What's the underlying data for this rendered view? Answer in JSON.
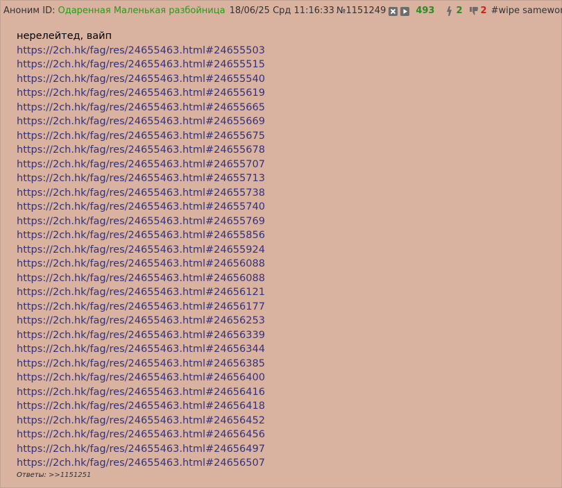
{
  "header": {
    "anon_label": "Аноним ID:",
    "poster_id": "Одаренная Маленькая разбойница",
    "date": "18/06/25 Срд 11:16:33",
    "post_number": "№1151249",
    "views": "493",
    "likes": "2",
    "dislikes": "2",
    "tag": "#wipe samewords",
    "colors": {
      "poster_id": "#2a9a18",
      "likes": "#2e8b1f",
      "dislikes": "#d0201a",
      "link": "#33327a",
      "background": "#d9b2a0"
    }
  },
  "body": {
    "first_line": "нерелейтед, вайп",
    "links": [
      "https://2ch.hk/fag/res/24655463.html#24655503",
      "https://2ch.hk/fag/res/24655463.html#24655515",
      "https://2ch.hk/fag/res/24655463.html#24655540",
      "https://2ch.hk/fag/res/24655463.html#24655619",
      "https://2ch.hk/fag/res/24655463.html#24655665",
      "https://2ch.hk/fag/res/24655463.html#24655669",
      "https://2ch.hk/fag/res/24655463.html#24655675",
      "https://2ch.hk/fag/res/24655463.html#24655678",
      "https://2ch.hk/fag/res/24655463.html#24655707",
      "https://2ch.hk/fag/res/24655463.html#24655713",
      "https://2ch.hk/fag/res/24655463.html#24655738",
      "https://2ch.hk/fag/res/24655463.html#24655740",
      "https://2ch.hk/fag/res/24655463.html#24655769",
      "https://2ch.hk/fag/res/24655463.html#24655856",
      "https://2ch.hk/fag/res/24655463.html#24655924",
      "https://2ch.hk/fag/res/24655463.html#24656088",
      "https://2ch.hk/fag/res/24655463.html#24656088",
      "https://2ch.hk/fag/res/24655463.html#24656121",
      "https://2ch.hk/fag/res/24655463.html#24656177",
      "https://2ch.hk/fag/res/24655463.html#24656253",
      "https://2ch.hk/fag/res/24655463.html#24656339",
      "https://2ch.hk/fag/res/24655463.html#24656344",
      "https://2ch.hk/fag/res/24655463.html#24656385",
      "https://2ch.hk/fag/res/24655463.html#24656400",
      "https://2ch.hk/fag/res/24655463.html#24656416",
      "https://2ch.hk/fag/res/24655463.html#24656418",
      "https://2ch.hk/fag/res/24655463.html#24656452",
      "https://2ch.hk/fag/res/24655463.html#24656456",
      "https://2ch.hk/fag/res/24655463.html#24656497",
      "https://2ch.hk/fag/res/24655463.html#24656507"
    ]
  },
  "replies": {
    "label": "Ответы:",
    "link": ">>1151251"
  },
  "icons": {
    "hide": "close-icon",
    "expand": "play-icon",
    "like": "thumbs-up-icon",
    "dislike": "thumbs-down-icon"
  }
}
